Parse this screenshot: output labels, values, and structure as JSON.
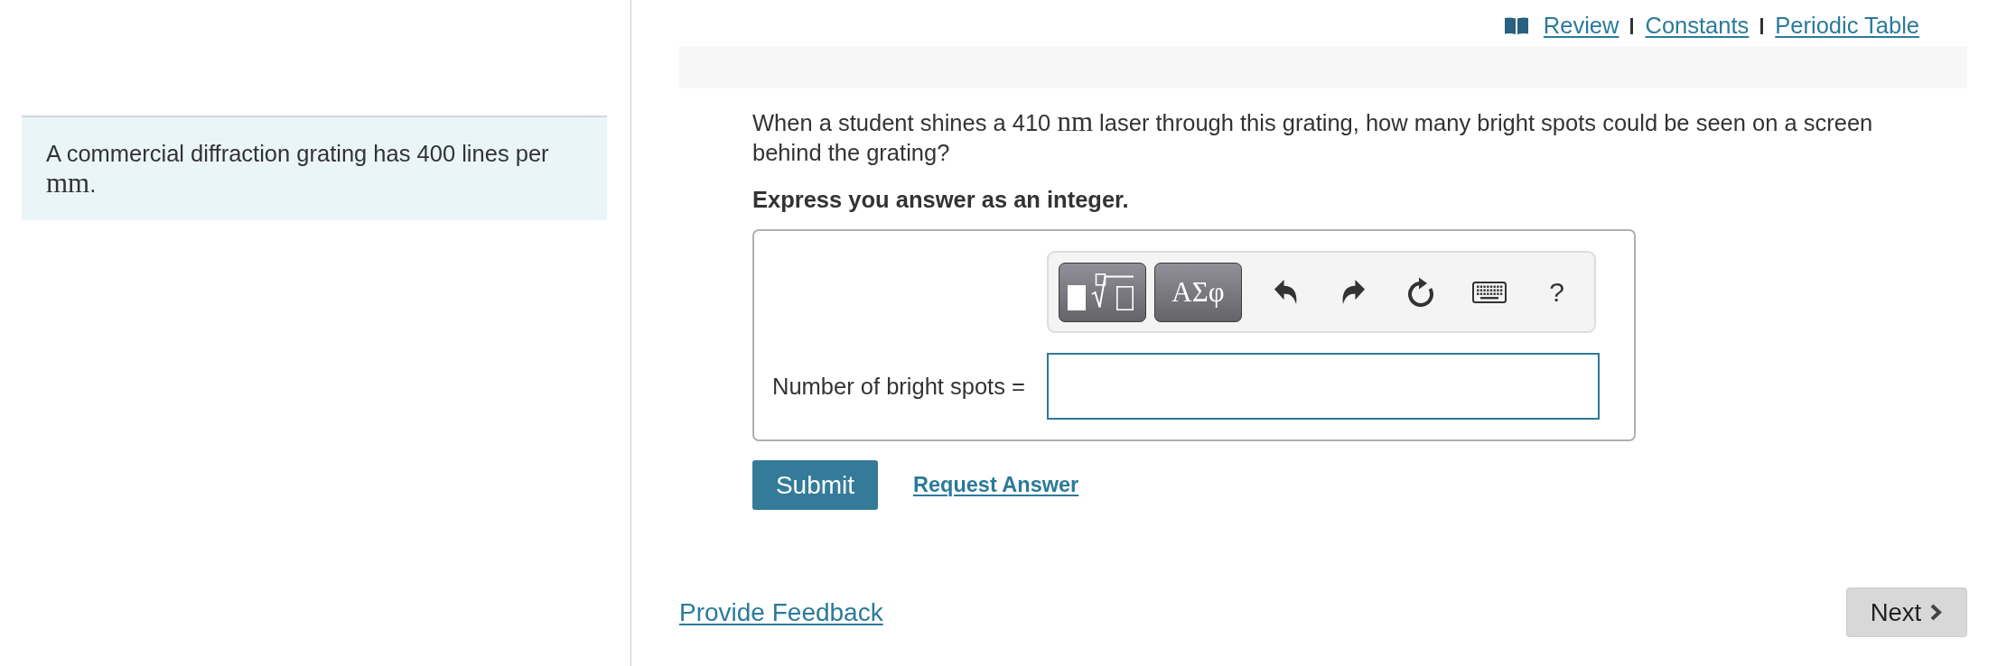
{
  "resource_links": [
    {
      "kind": "book",
      "label": "Review"
    },
    {
      "kind": "text",
      "label": "Constants"
    },
    {
      "kind": "text",
      "label": "Periodic Table"
    }
  ],
  "context_panel": {
    "text_parts": [
      {
        "kind": "text",
        "text": "A commercial diffraction grating has 400 lines per "
      },
      {
        "kind": "math",
        "text": "mm"
      },
      {
        "kind": "text",
        "text": "."
      }
    ]
  },
  "question": {
    "text_parts": [
      {
        "kind": "text",
        "text": "When a student shines a 410 "
      },
      {
        "kind": "math",
        "text": "nm"
      },
      {
        "kind": "text",
        "text": " laser through this grating, how many bright spots could be seen on a screen behind the grating?"
      }
    ],
    "instruction": "Express you answer as an integer."
  },
  "answer_box": {
    "toolbar": {
      "symbols_button": "ΑΣφ",
      "help_button": "?"
    },
    "field_label": "Number of bright spots ="
  },
  "actions": {
    "submit_button": "Submit",
    "request_answer_link": "Request Answer"
  },
  "footer": {
    "feedback_link": "Provide Feedback",
    "next_button": "Next"
  }
}
